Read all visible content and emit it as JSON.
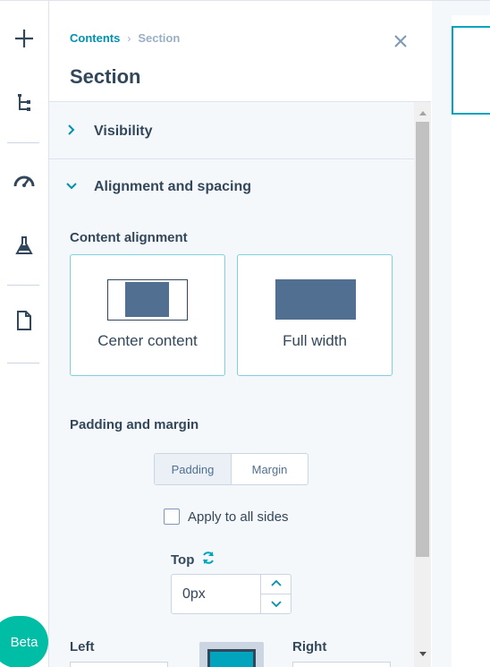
{
  "rail": {
    "items": [
      {
        "icon": "plus-icon"
      },
      {
        "icon": "tree-structure-icon"
      },
      {
        "icon": "speedometer-icon"
      },
      {
        "icon": "flask-icon"
      },
      {
        "icon": "document-icon"
      }
    ],
    "beta_label": "Beta"
  },
  "header": {
    "breadcrumb_root": "Contents",
    "breadcrumb_separator": "›",
    "breadcrumb_current": "Section",
    "title": "Section"
  },
  "accordion": {
    "visibility_label": "Visibility",
    "alignment_label": "Alignment and spacing"
  },
  "content_alignment": {
    "label": "Content alignment",
    "options": [
      {
        "label": "Center content"
      },
      {
        "label": "Full width"
      }
    ]
  },
  "padding_margin": {
    "label": "Padding and margin",
    "tabs": [
      "Padding",
      "Margin"
    ],
    "active_tab": "Padding",
    "apply_all_label": "Apply to all sides",
    "apply_all_checked": false,
    "top_label": "Top",
    "top_value": "0px",
    "left_label": "Left",
    "right_label": "Right"
  },
  "colors": {
    "accent": "#00a4bd",
    "link": "#0091ae",
    "text": "#33475b",
    "block_fill": "#516f90",
    "beta": "#00bda5"
  }
}
